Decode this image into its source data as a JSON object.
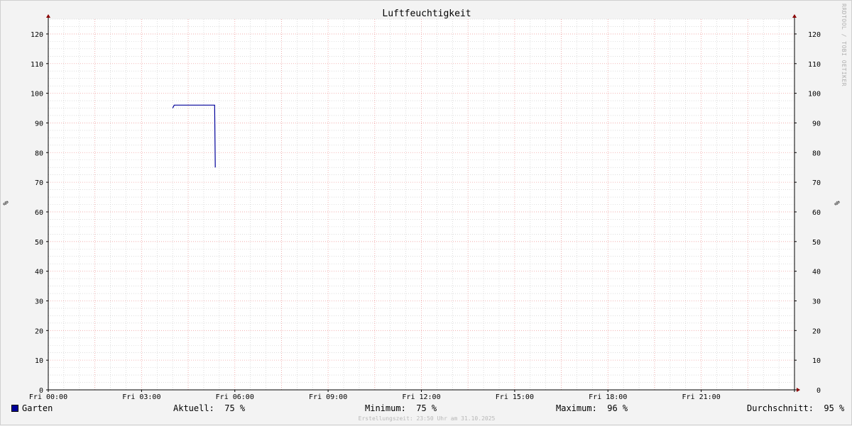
{
  "title": "Luftfeuchtigkeit",
  "watermark": "RRDTOOL / TOBI OETIKER",
  "unit_label": "%",
  "colors": {
    "background": "#f3f3f3",
    "plot_background": "#ffffff",
    "major_grid": "#f0a0a0",
    "minor_grid": "#c8c8c8",
    "axis": "#000000",
    "arrow": "#8b0000",
    "series": "#000099"
  },
  "legend": {
    "series_name": "Garten",
    "aktuell_label": "Aktuell:",
    "aktuell_value": "75 %",
    "minimum_label": "Minimum:",
    "minimum_value": "75 %",
    "maximum_label": "Maximum:",
    "maximum_value": "96 %",
    "durchschnitt_label": "Durchschnitt:",
    "durchschnitt_value": "95 %"
  },
  "footer": "Erstellungszeit: 23:50 Uhr am 31.10.2025",
  "chart_data": {
    "type": "line",
    "title": "Luftfeuchtigkeit",
    "xlabel": "",
    "ylabel": "%",
    "xlim": [
      0,
      24
    ],
    "ylim": [
      0,
      125
    ],
    "x_ticks": [
      0,
      3,
      6,
      9,
      12,
      15,
      18,
      21
    ],
    "x_tick_labels": [
      "Fri 00:00",
      "Fri 03:00",
      "Fri 06:00",
      "Fri 09:00",
      "Fri 12:00",
      "Fri 15:00",
      "Fri 18:00",
      "Fri 21:00"
    ],
    "y_ticks": [
      0,
      10,
      20,
      30,
      40,
      50,
      60,
      70,
      80,
      90,
      100,
      110,
      120
    ],
    "grid": true,
    "series": [
      {
        "name": "Garten",
        "color": "#000099",
        "x": [
          4.0,
          4.05,
          5.35,
          5.35,
          5.37
        ],
        "values": [
          95,
          96,
          96,
          96,
          75
        ]
      }
    ]
  }
}
